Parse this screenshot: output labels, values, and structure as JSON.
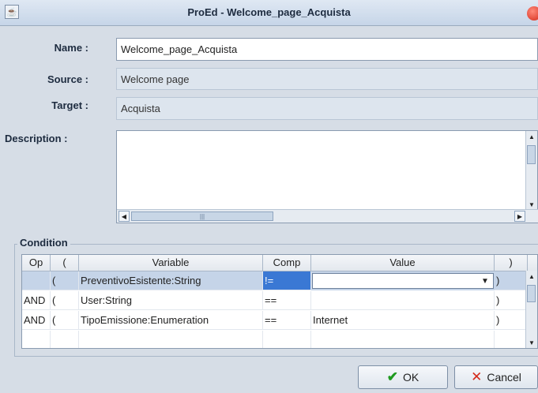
{
  "window": {
    "title": "ProEd - Welcome_page_Acquista"
  },
  "form": {
    "name_label": "Name :",
    "name_value": "Welcome_page_Acquista",
    "source_label": "Source :",
    "source_value": "Welcome page",
    "target_label": "Target :",
    "target_value": "Acquista",
    "description_label": "Description :",
    "description_value": ""
  },
  "condition": {
    "group_title": "Condition",
    "columns": [
      "Op",
      "(",
      "Variable",
      "Comp",
      "Value",
      ")"
    ],
    "rows": [
      {
        "op": "",
        "open": "(",
        "variable": "PreventivoEsistente:String",
        "comp": "!=",
        "value": "",
        "close": ")"
      },
      {
        "op": "AND",
        "open": "(",
        "variable": "User:String",
        "comp": "==",
        "value": "",
        "close": ")"
      },
      {
        "op": "AND",
        "open": "(",
        "variable": "TipoEmissione:Enumeration",
        "comp": "==",
        "value": "Internet",
        "close": ")"
      }
    ]
  },
  "buttons": {
    "ok": "OK",
    "cancel": "Cancel"
  }
}
